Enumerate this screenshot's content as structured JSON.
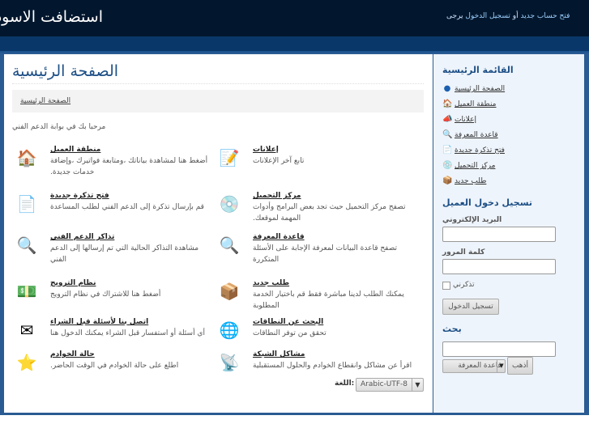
{
  "header": {
    "site_title": "استضافت الاسود",
    "prefix": "يرجى",
    "login_link": "تسجيل الدخول",
    "or": "أو",
    "register_link": "فتح حساب جديد"
  },
  "main": {
    "title": "الصفحة الرئيسية",
    "breadcrumb": "الصفحة الرئيسية",
    "welcome": "مرحبا بك في بوابة الدعم الفني",
    "items": [
      {
        "title": "منطقة العميل",
        "desc": "أضغط هنا لمشاهدة بياناتك ،ومتابعة فواتيرك ،وإضافة خدمات جديدة.",
        "icon": "house-icon"
      },
      {
        "title": "إعلانات",
        "desc": "تابع آخر الإعلانات",
        "icon": "notepad-icon"
      },
      {
        "title": "فتح تذكرة جديدة",
        "desc": "قم بإرسال تذكرة إلى الدعم الفني لطلب المساعدة",
        "icon": "ticket-icon"
      },
      {
        "title": "مركز التحميل",
        "desc": "تصفح مركز التحميل حيث تجد بعض البرامج وأدوات المهمة لموقعك.",
        "icon": "cd-icon"
      },
      {
        "title": "تذاكر الدعم الفني",
        "desc": "مشاهدة التذاكر الحالية التي تم إرسالها إلى الدعم الفني",
        "icon": "magnifier-doc-icon"
      },
      {
        "title": "قاعدة المعرفة",
        "desc": "تصفح قاعدة البيانات لمعرفة الإجابة على الأسئلة المتكررة",
        "icon": "magnifier-icon"
      },
      {
        "title": "نظام الترويج",
        "desc": "أضغط هنا للاشتراك في نظام الترويج",
        "icon": "money-icon"
      },
      {
        "title": "طلب جديد",
        "desc": "يمكنك الطلب لدينا مباشرة فقط قم باختيار الخدمة المطلوبة",
        "icon": "box-icon"
      },
      {
        "title": "اتصل بنا لأسئلة قبل الشراء",
        "desc": "أي أسئلة أو استفسار قبل الشراء يمكنك الدخول هنا",
        "icon": "mail-icon"
      },
      {
        "title": "البحث عن النطاقات",
        "desc": "تحقق من توفر النطاقات",
        "icon": "globe-icon"
      },
      {
        "title": "حالة الخوادم",
        "desc": "اطلع على حالة الخوادم في الوقت الحاضر.",
        "icon": "star-icon"
      },
      {
        "title": "مشاكل الشبكة",
        "desc": "اقرأ عن مشاكل وانقطاع الخوادم والحلول المستقبلية",
        "icon": "antenna-icon"
      }
    ],
    "language_label": ":اللغة",
    "language_value": "Arabic-UTF-8"
  },
  "sidebar": {
    "menu_title": "القائمة الرئيسية",
    "menu": [
      {
        "label": "الصفحة الرئيسية",
        "icon": "home-circle-icon"
      },
      {
        "label": "منطقة العميل",
        "icon": "house-icon"
      },
      {
        "label": "إعلانات",
        "icon": "announcement-icon"
      },
      {
        "label": "قاعدة المعرفة",
        "icon": "magnifier-icon"
      },
      {
        "label": "فتح تذكرة جديدة",
        "icon": "ticket-icon"
      },
      {
        "label": "مركز التحميل",
        "icon": "cd-icon"
      },
      {
        "label": "طلب جديد",
        "icon": "box-icon"
      }
    ],
    "login_title": "تسجيل دخول العميل",
    "email_label": "البريد الإلكتروني",
    "password_label": "كلمة المرور",
    "remember": "تذكرني",
    "login_button": "تسجيل الدخول",
    "search_title": "بحث",
    "search_select": "قاعدة المعرفة",
    "go_button": "أذهب"
  }
}
